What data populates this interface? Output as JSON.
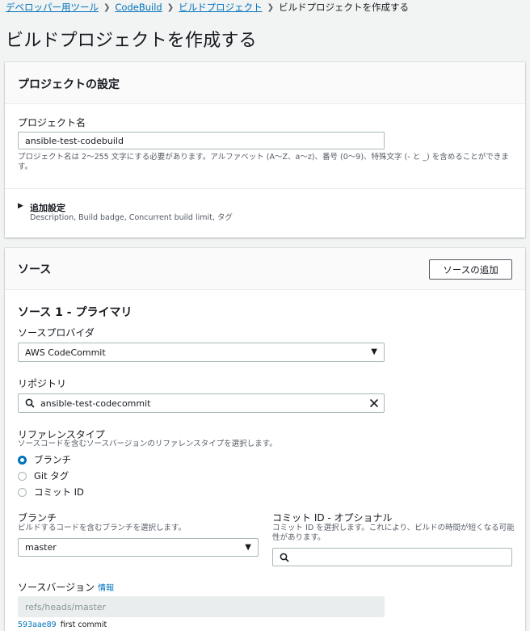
{
  "breadcrumb": {
    "items": [
      "デベロッパー用ツール",
      "CodeBuild",
      "ビルドプロジェクト"
    ],
    "current": "ビルドプロジェクトを作成する"
  },
  "page_title": "ビルドプロジェクトを作成する",
  "project_settings": {
    "title": "プロジェクトの設定",
    "name_label": "プロジェクト名",
    "name_value": "ansible-test-codebuild",
    "name_hint": "プロジェクト名は 2〜255 文字にする必要があります。アルファベット (A〜Z、a〜z)、番号 (0〜9)、特殊文字 (- と _) を含めることができます。",
    "additional_title": "追加設定",
    "additional_desc": "Description, Build badge, Concurrent build limit, タグ"
  },
  "source": {
    "title": "ソース",
    "add_button": "ソースの追加",
    "primary_title": "ソース 1 - プライマリ",
    "provider_label": "ソースプロバイダ",
    "provider_value": "AWS CodeCommit",
    "repo_label": "リポジトリ",
    "repo_value": "ansible-test-codecommit",
    "ref_type_label": "リファレンスタイプ",
    "ref_type_desc": "ソースコードを含むソースバージョンのリファレンスタイプを選択します。",
    "ref_options": [
      {
        "label": "ブランチ",
        "selected": true
      },
      {
        "label": "Git タグ",
        "selected": false
      },
      {
        "label": "コミット ID",
        "selected": false
      }
    ],
    "branch_label": "ブランチ",
    "branch_desc": "ビルドするコードを含むブランチを選択します。",
    "branch_value": "master",
    "commit_label": "コミット ID - オプショナル",
    "commit_desc": "コミット ID を選択します。これにより、ビルドの時間が短くなる可能性があります。",
    "commit_value": "",
    "version_label": "ソースバージョン",
    "version_info": "情報",
    "version_value": "refs/heads/master",
    "commit_hash": "593aae89",
    "commit_message": "first commit"
  },
  "colors": {
    "link": "#0073bb",
    "radio_selected": "#0073bb",
    "disabled_input_bg": "#eaeded"
  }
}
